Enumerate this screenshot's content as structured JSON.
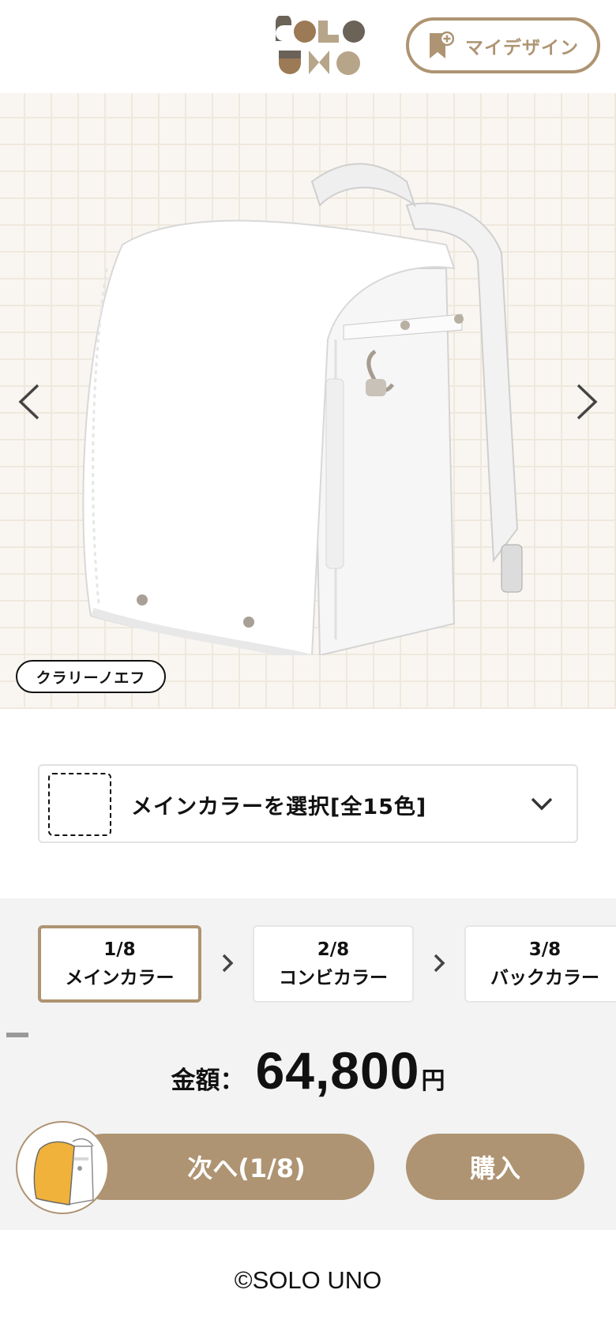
{
  "header": {
    "logo_text": "SOLO UNO",
    "mydesign_label": "マイデザイン",
    "mydesign_icon": "bookmark-plus-icon"
  },
  "hero": {
    "model_name": "クラリーノエフ",
    "prev_icon": "chevron-left-icon",
    "next_icon": "chevron-right-icon"
  },
  "color_select": {
    "label": "メインカラーを選択[全15色]",
    "icon": "chevron-down-icon"
  },
  "steps": [
    {
      "number": "1/8",
      "label": "メインカラー",
      "active": true
    },
    {
      "number": "2/8",
      "label": "コンビカラー",
      "active": false
    },
    {
      "number": "3/8",
      "label": "バックカラー",
      "active": false
    }
  ],
  "progress": {
    "current": 1,
    "total": 8
  },
  "price": {
    "label": "金額：",
    "value": "64,800",
    "unit": "円"
  },
  "actions": {
    "next_label": "次へ(1/8)",
    "buy_label": "購入"
  },
  "footer": {
    "copyright": "©SOLO UNO"
  },
  "colors": {
    "accent": "#ae9472",
    "grid_bg": "#f9f6f1",
    "panel_bg": "#f3f3f3",
    "thumb_bag": "#f0b23a"
  }
}
